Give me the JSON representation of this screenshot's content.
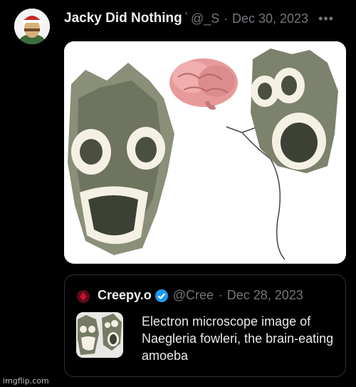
{
  "tweet": {
    "display_name": "Jacky Did Nothing W",
    "handle": "@_S",
    "separator": "·",
    "date": "Dec 30, 2023",
    "more_icon": "ellipsis-icon",
    "media_alt_icon": "brain-icon"
  },
  "quote": {
    "display_name": "Creepy.o",
    "verified_icon": "verified-badge-icon",
    "handle": "@Creep",
    "separator": "·",
    "date": "Dec 28, 2023",
    "text": "Electron microscope image of Naegleria fowleri, the brain-eating amoeba"
  },
  "colors": {
    "background": "#000000",
    "secondary_text": "#71767b",
    "verified": "#1d9bf0",
    "quote_border": "#2f3336"
  },
  "watermark": "imgflip.com"
}
